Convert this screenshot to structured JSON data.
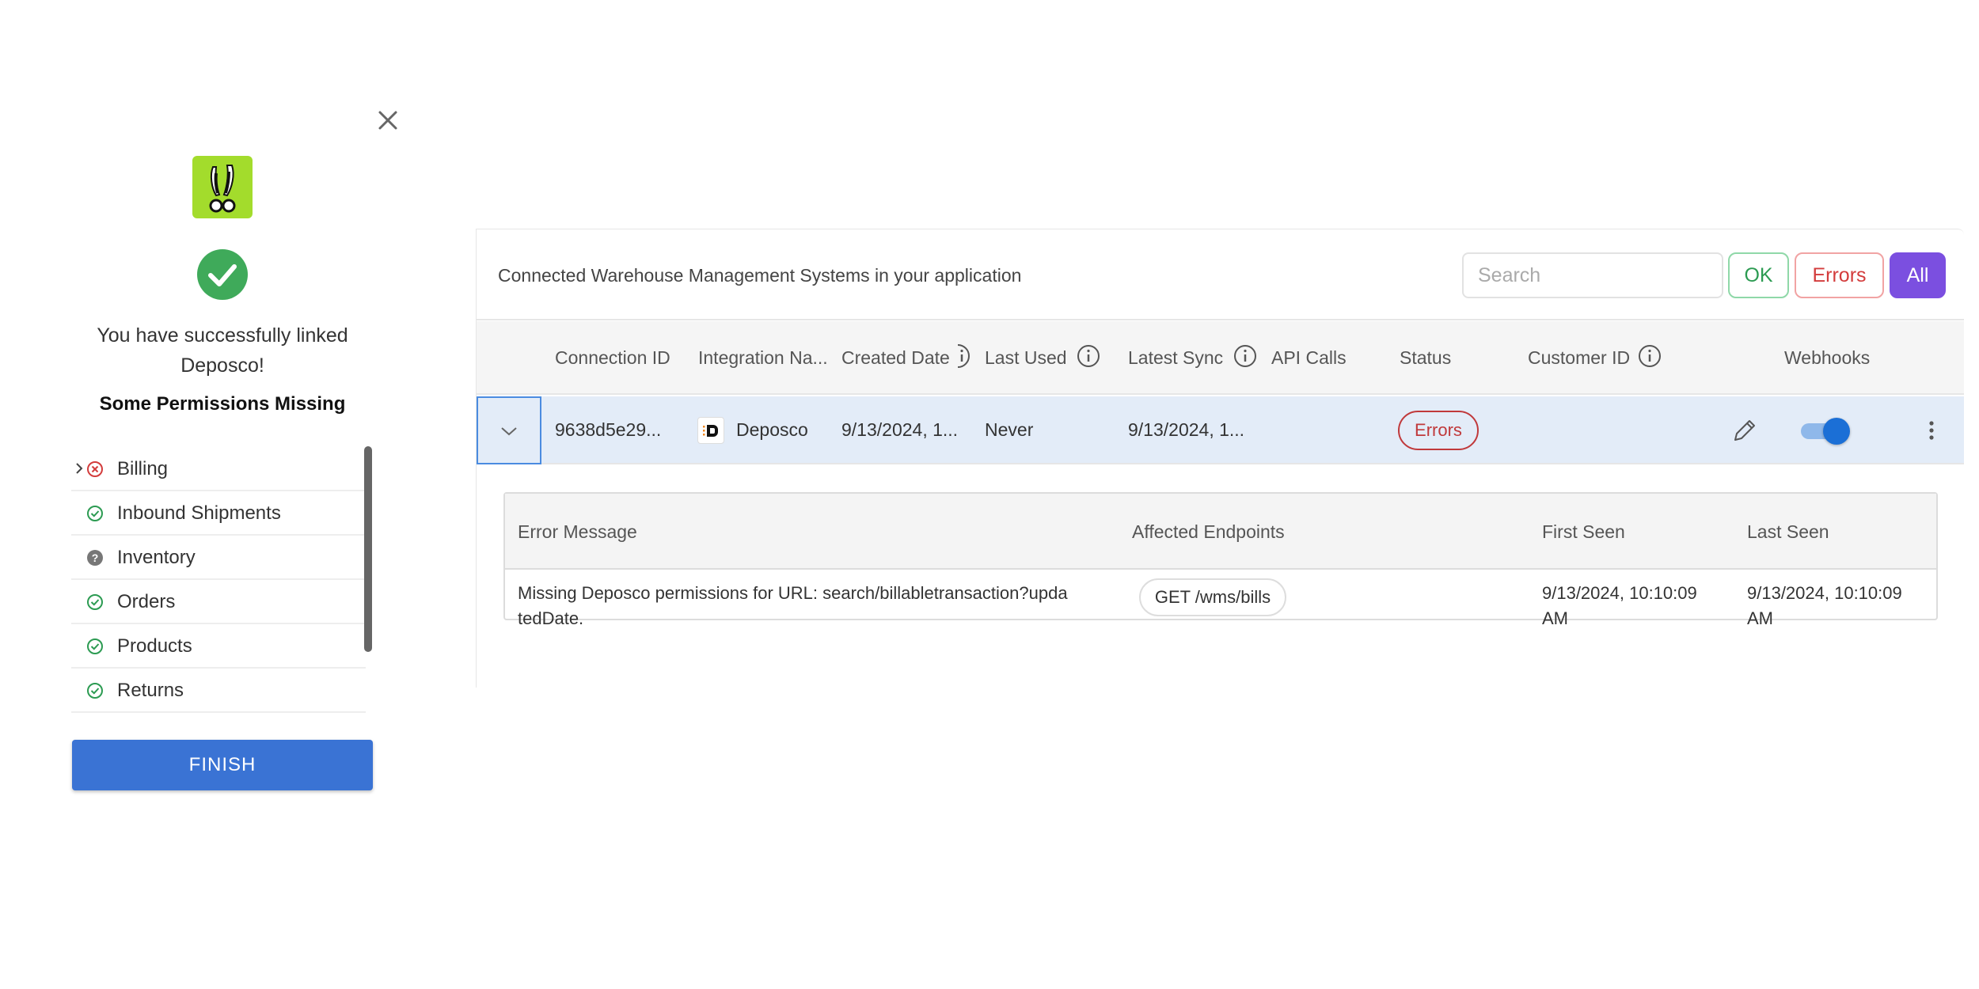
{
  "modal": {
    "success_line1": "You have successfully linked",
    "success_line2": "Deposco!",
    "permissions_title": "Some Permissions Missing",
    "permissions": [
      {
        "label": "Billing",
        "status": "error"
      },
      {
        "label": "Inbound Shipments",
        "status": "ok"
      },
      {
        "label": "Inventory",
        "status": "unknown"
      },
      {
        "label": "Orders",
        "status": "ok"
      },
      {
        "label": "Products",
        "status": "ok"
      },
      {
        "label": "Returns",
        "status": "ok"
      }
    ],
    "finish_label": "FINISH"
  },
  "panel": {
    "title": "Connected Warehouse Management Systems in your application",
    "search_placeholder": "Search",
    "filters": {
      "ok": "OK",
      "errors": "Errors",
      "all": "All"
    },
    "columns": {
      "connection_id": "Connection ID",
      "integration_name": "Integration Na...",
      "created_date": "Created Date",
      "last_used": "Last Used",
      "latest_sync": "Latest Sync",
      "api_calls": "API Calls",
      "status": "Status",
      "customer_id": "Customer ID",
      "webhooks": "Webhooks"
    },
    "row": {
      "connection_id": "9638d5e29...",
      "integration_name": "Deposco",
      "created_date": "9/13/2024, 1...",
      "last_used": "Never",
      "latest_sync": "9/13/2024, 1...",
      "status": "Errors",
      "webhooks_enabled": true
    },
    "errors_table": {
      "columns": {
        "message": "Error Message",
        "endpoints": "Affected Endpoints",
        "first_seen": "First Seen",
        "last_seen": "Last Seen"
      },
      "row": {
        "message": "Missing Deposco permissions for URL: search/billabletransaction?updatedDate.",
        "endpoint": "GET /wms/bills",
        "first_seen": "9/13/2024, 10:10:09 AM",
        "last_seen": "9/13/2024, 10:10:09 AM"
      }
    }
  },
  "colors": {
    "accent": "#7b4fe0",
    "primary_button": "#3a73d4",
    "ok": "#2c9b52",
    "error": "#c0393b",
    "logo_bg": "#a3dc2c"
  }
}
